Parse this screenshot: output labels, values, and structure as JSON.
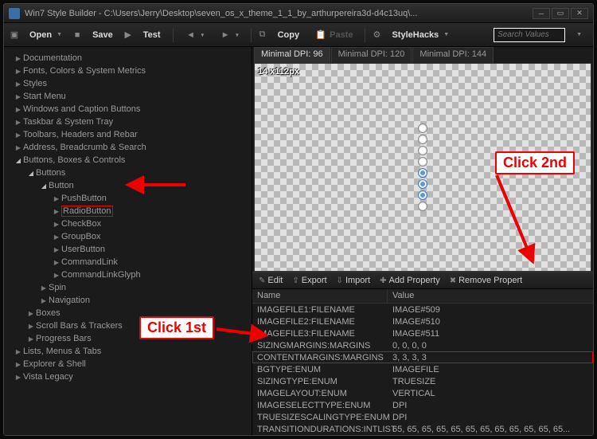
{
  "title": "Win7 Style Builder - C:\\Users\\Jerry\\Desktop\\seven_os_x_theme_1_1_by_arthurpereira3d-d4c13uq\\...",
  "toolbar": {
    "open": "Open",
    "save": "Save",
    "test": "Test",
    "copy": "Copy",
    "paste": "Paste",
    "stylehacks": "StyleHacks",
    "search_placeholder": "Search Values"
  },
  "tree": [
    {
      "lvl": 0,
      "exp": "▶",
      "label": "Documentation"
    },
    {
      "lvl": 0,
      "exp": "▶",
      "label": "Fonts, Colors & System Metrics"
    },
    {
      "lvl": 0,
      "exp": "▶",
      "label": "Styles"
    },
    {
      "lvl": 0,
      "exp": "▶",
      "label": "Start Menu"
    },
    {
      "lvl": 0,
      "exp": "▶",
      "label": "Windows and Caption Buttons"
    },
    {
      "lvl": 0,
      "exp": "▶",
      "label": "Taskbar & System Tray"
    },
    {
      "lvl": 0,
      "exp": "▶",
      "label": "Toolbars, Headers and Rebar"
    },
    {
      "lvl": 0,
      "exp": "▶",
      "label": "Address, Breadcrumb & Search"
    },
    {
      "lvl": 0,
      "exp": "◢",
      "label": "Buttons, Boxes & Controls"
    },
    {
      "lvl": 1,
      "exp": "◢",
      "label": "Buttons"
    },
    {
      "lvl": 2,
      "exp": "◢",
      "label": "Button"
    },
    {
      "lvl": 3,
      "exp": "▶",
      "label": "PushButton"
    },
    {
      "lvl": 3,
      "exp": "▶",
      "label": "RadioButton",
      "selected": true
    },
    {
      "lvl": 3,
      "exp": "▶",
      "label": "CheckBox"
    },
    {
      "lvl": 3,
      "exp": "▶",
      "label": "GroupBox"
    },
    {
      "lvl": 3,
      "exp": "▶",
      "label": "UserButton"
    },
    {
      "lvl": 3,
      "exp": "▶",
      "label": "CommandLink"
    },
    {
      "lvl": 3,
      "exp": "▶",
      "label": "CommandLinkGlyph"
    },
    {
      "lvl": 2,
      "exp": "▶",
      "label": "Spin"
    },
    {
      "lvl": 2,
      "exp": "▶",
      "label": "Navigation"
    },
    {
      "lvl": 1,
      "exp": "▶",
      "label": "Boxes"
    },
    {
      "lvl": 1,
      "exp": "▶",
      "label": "Scroll Bars & Trackers"
    },
    {
      "lvl": 1,
      "exp": "▶",
      "label": "Progress Bars"
    },
    {
      "lvl": 0,
      "exp": "▶",
      "label": "Lists, Menus & Tabs"
    },
    {
      "lvl": 0,
      "exp": "▶",
      "label": "Explorer & Shell"
    },
    {
      "lvl": 0,
      "exp": "▶",
      "label": "Vista Legacy"
    }
  ],
  "dpi_tabs": [
    "Minimal DPI: 96",
    "Minimal DPI: 120",
    "Minimal DPI: 144"
  ],
  "preview_dim": "14 x112px",
  "prop_toolbar": {
    "edit": "Edit",
    "export": "Export",
    "import": "Import",
    "addprop": "Add Property",
    "removeprop": "Remove Propert"
  },
  "prop_header": {
    "name": "Name",
    "value": "Value"
  },
  "properties": [
    {
      "name": "IMAGEFILE1:FILENAME",
      "value": "IMAGE#509"
    },
    {
      "name": "IMAGEFILE2:FILENAME",
      "value": "IMAGE#510"
    },
    {
      "name": "IMAGEFILE3:FILENAME",
      "value": "IMAGE#511"
    },
    {
      "name": "SIZINGMARGINS:MARGINS",
      "value": "0, 0, 0, 0"
    },
    {
      "name": "CONTENTMARGINS:MARGINS",
      "value": "3, 3, 3, 3",
      "hl": true
    },
    {
      "name": "BGTYPE:ENUM",
      "value": "IMAGEFILE"
    },
    {
      "name": "SIZINGTYPE:ENUM",
      "value": "TRUESIZE"
    },
    {
      "name": "IMAGELAYOUT:ENUM",
      "value": "VERTICAL"
    },
    {
      "name": "IMAGESELECTTYPE:ENUM",
      "value": "DPI"
    },
    {
      "name": "TRUESIZESCALINGTYPE:ENUM",
      "value": "DPI"
    },
    {
      "name": "TRANSITIONDURATIONS:INTLIST",
      "value": "65, 65, 65, 65, 65, 65, 65, 65, 65, 65, 65, 65..."
    }
  ],
  "annotations": {
    "click1": "Click 1st",
    "click2": "Click 2nd"
  }
}
